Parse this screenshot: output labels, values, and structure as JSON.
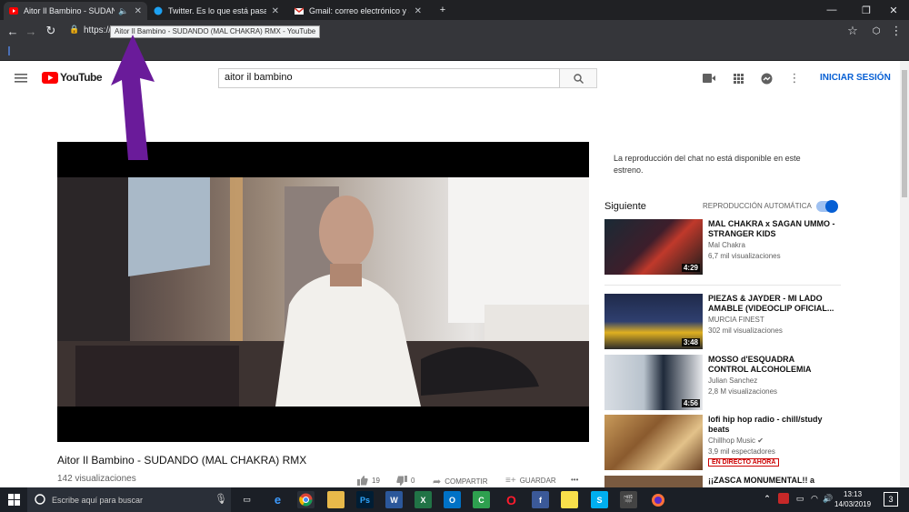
{
  "browser": {
    "tabs": [
      {
        "title": "Aitor Il Bambino - SUDANDO",
        "active": true,
        "favicon": "youtube-icon"
      },
      {
        "title": "Twitter. Es lo que está pasando.",
        "active": false,
        "favicon": "twitter-icon"
      },
      {
        "title": "Gmail: correo electrónico y alma",
        "active": false,
        "favicon": "gmail-icon"
      }
    ],
    "url": "https://ww",
    "tooltip": "Aitor Il Bambino - SUDANDO (MAL CHAKRA) RMX - YouTube"
  },
  "youtube": {
    "logo_text": "YouTube",
    "search_value": "aitor il bambino",
    "signin_label": "INICIAR SESIÓN"
  },
  "video": {
    "title": "Aitor Il Bambino - SUDANDO (MAL CHAKRA) RMX",
    "views": "142 visualizaciones",
    "likes": "19",
    "dislikes": "0",
    "share_label": "COMPARTIR",
    "save_label": "GUARDAR",
    "more_label": "•••"
  },
  "sidebar": {
    "chat_note": "La reproducción del chat no está disponible en este estreno.",
    "next_label": "Siguiente",
    "autoplay_label": "REPRODUCCIÓN AUTOMÁTICA",
    "autoplay_on": true,
    "recommendations": [
      {
        "title": "MAL CHAKRA x SAGAN UMMO - STRANGER KIDS",
        "channel": "Mal Chakra",
        "views": "6,7 mil visualizaciones",
        "duration": "4:29",
        "live": ""
      },
      {
        "title": "PIEZAS & JAYDER - MI LADO AMABLE (VIDEOCLIP OFICIAL...",
        "channel": "MURCIA FINEST",
        "views": "302 mil visualizaciones",
        "duration": "3:48",
        "live": ""
      },
      {
        "title": "MOSSO d'ESQUADRA CONTROL ALCOHOLEMIA",
        "channel": "Julian Sanchez",
        "views": "2,8 M visualizaciones",
        "duration": "4:56",
        "live": ""
      },
      {
        "title": "lofi hip hop radio - chill/study beats",
        "channel": "Chillhop Music",
        "views": "3,9 mil espectadores",
        "duration": "",
        "live": "EN DIRECTO AHORA"
      },
      {
        "title": "¡¡ZASCA MONUMENTAL!! a",
        "channel": "",
        "views": "",
        "duration": "",
        "live": ""
      }
    ]
  },
  "taskbar": {
    "search_placeholder": "Escribe aquí para buscar",
    "time": "13:13",
    "date": "14/03/2019",
    "notifications": "3"
  },
  "colors": {
    "youtube_red": "#ff0000",
    "link_blue": "#065fd4",
    "annotation_arrow": "#6a1b9a"
  }
}
